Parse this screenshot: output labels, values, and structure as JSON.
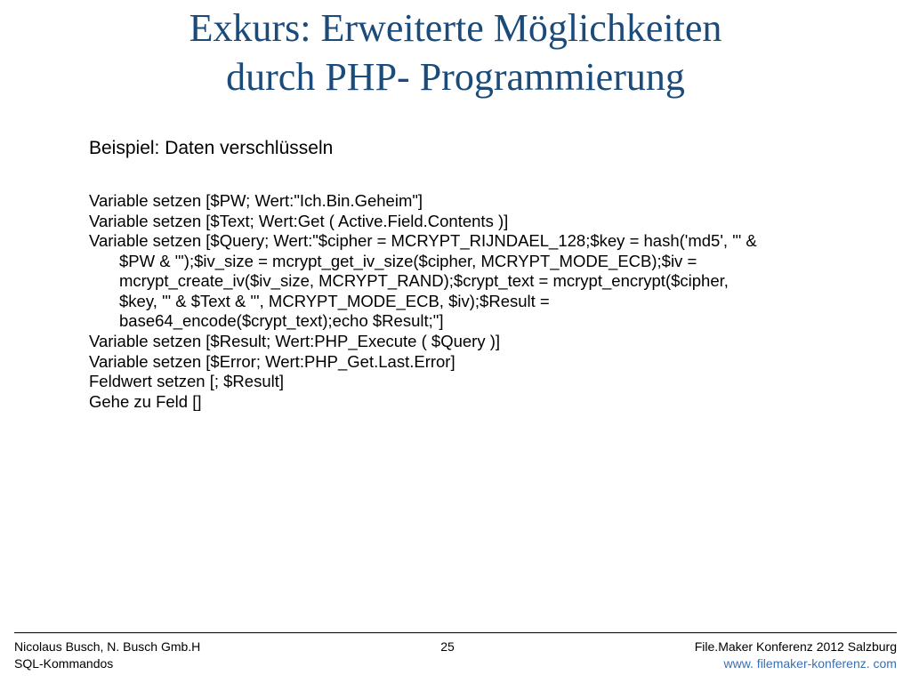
{
  "title": {
    "line1": "Exkurs: Erweiterte Möglichkeiten",
    "line2": "durch PHP- Programmierung"
  },
  "subtitle": "Beispiel: Daten verschlüsseln",
  "code": {
    "l1": "Variable setzen [$PW; Wert:\"Ich.Bin.Geheim\"]",
    "l2": "Variable setzen [$Text; Wert:Get ( Active.Field.Contents )]",
    "l3a": "Variable setzen [$Query; Wert:\"$cipher = MCRYPT_RIJNDAEL_128;$key = hash('md5', '\" &",
    "l3b": "$PW & \"');$iv_size = mcrypt_get_iv_size($cipher, MCRYPT_MODE_ECB);$iv =",
    "l3c": "mcrypt_create_iv($iv_size, MCRYPT_RAND);$crypt_text = mcrypt_encrypt($cipher,",
    "l3d": "$key, '\" & $Text & \"', MCRYPT_MODE_ECB, $iv);$Result =",
    "l3e": "base64_encode($crypt_text);echo $Result;\"]",
    "l4": "Variable setzen [$Result; Wert:PHP_Execute ( $Query )]",
    "l5": "Variable setzen [$Error; Wert:PHP_Get.Last.Error]",
    "l6": "Feldwert setzen [; $Result]",
    "l7": "Gehe zu Feld []"
  },
  "footer": {
    "left_line1": "Nicolaus Busch, N. Busch Gmb.H",
    "left_line2": "SQL-Kommandos",
    "page_number": "25",
    "right_line1": "File.Maker Konferenz 2012 Salzburg",
    "right_line2": "www. filemaker-konferenz. com"
  }
}
